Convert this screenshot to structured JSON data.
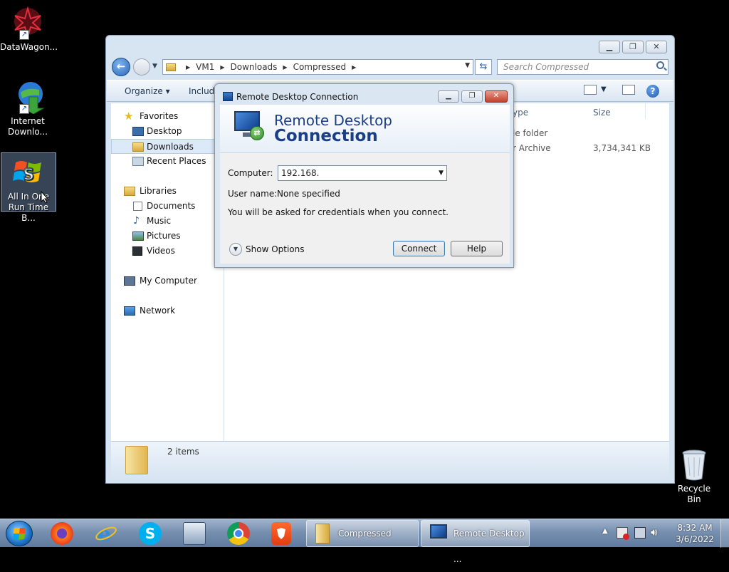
{
  "desktop": {
    "icons": [
      {
        "label": "DataWagon...",
        "name": "datawagon"
      },
      {
        "label_line1": "Internet",
        "label_line2": "Downlo...",
        "name": "internet-download-manager"
      },
      {
        "label_line1": "All In One",
        "label_line2": "Run Time B...",
        "name": "all-in-one-runtimes"
      }
    ],
    "recycle_bin": "Recycle Bin"
  },
  "explorer": {
    "address": {
      "segments": [
        "VM1",
        "Downloads",
        "Compressed"
      ]
    },
    "search_placeholder": "Search Compressed",
    "commands": {
      "organize": "Organize",
      "include": "Include"
    },
    "nav": {
      "favorites": "Favorites",
      "desktop": "Desktop",
      "downloads": "Downloads",
      "recent_places": "Recent Places",
      "libraries": "Libraries",
      "documents": "Documents",
      "music": "Music",
      "pictures": "Pictures",
      "videos": "Videos",
      "my_computer": "My Computer",
      "network": "Network"
    },
    "columns": {
      "type": "ype",
      "size": "Size"
    },
    "rows": [
      {
        "type": "le folder",
        "size": ""
      },
      {
        "type": "r Archive",
        "size": "3,734,341 KB"
      }
    ],
    "details": {
      "count": "2 items"
    }
  },
  "rdc": {
    "window_title": "Remote Desktop Connection",
    "banner_line1": "Remote Desktop",
    "banner_line2": "Connection",
    "computer_label": "Computer:",
    "computer_value": "192.168.",
    "username_label": "User name:",
    "username_value": "None specified",
    "info": "You will be asked for credentials when you connect.",
    "show_options": "Show Options",
    "connect": "Connect",
    "help": "Help"
  },
  "taskbar": {
    "tasks": [
      {
        "label": "Compressed"
      },
      {
        "label": "Remote Desktop ..."
      }
    ],
    "time": "8:32 AM",
    "date": "3/6/2022"
  },
  "colors": {
    "accent": "#1b3f86",
    "selection": "#dce9f8"
  }
}
